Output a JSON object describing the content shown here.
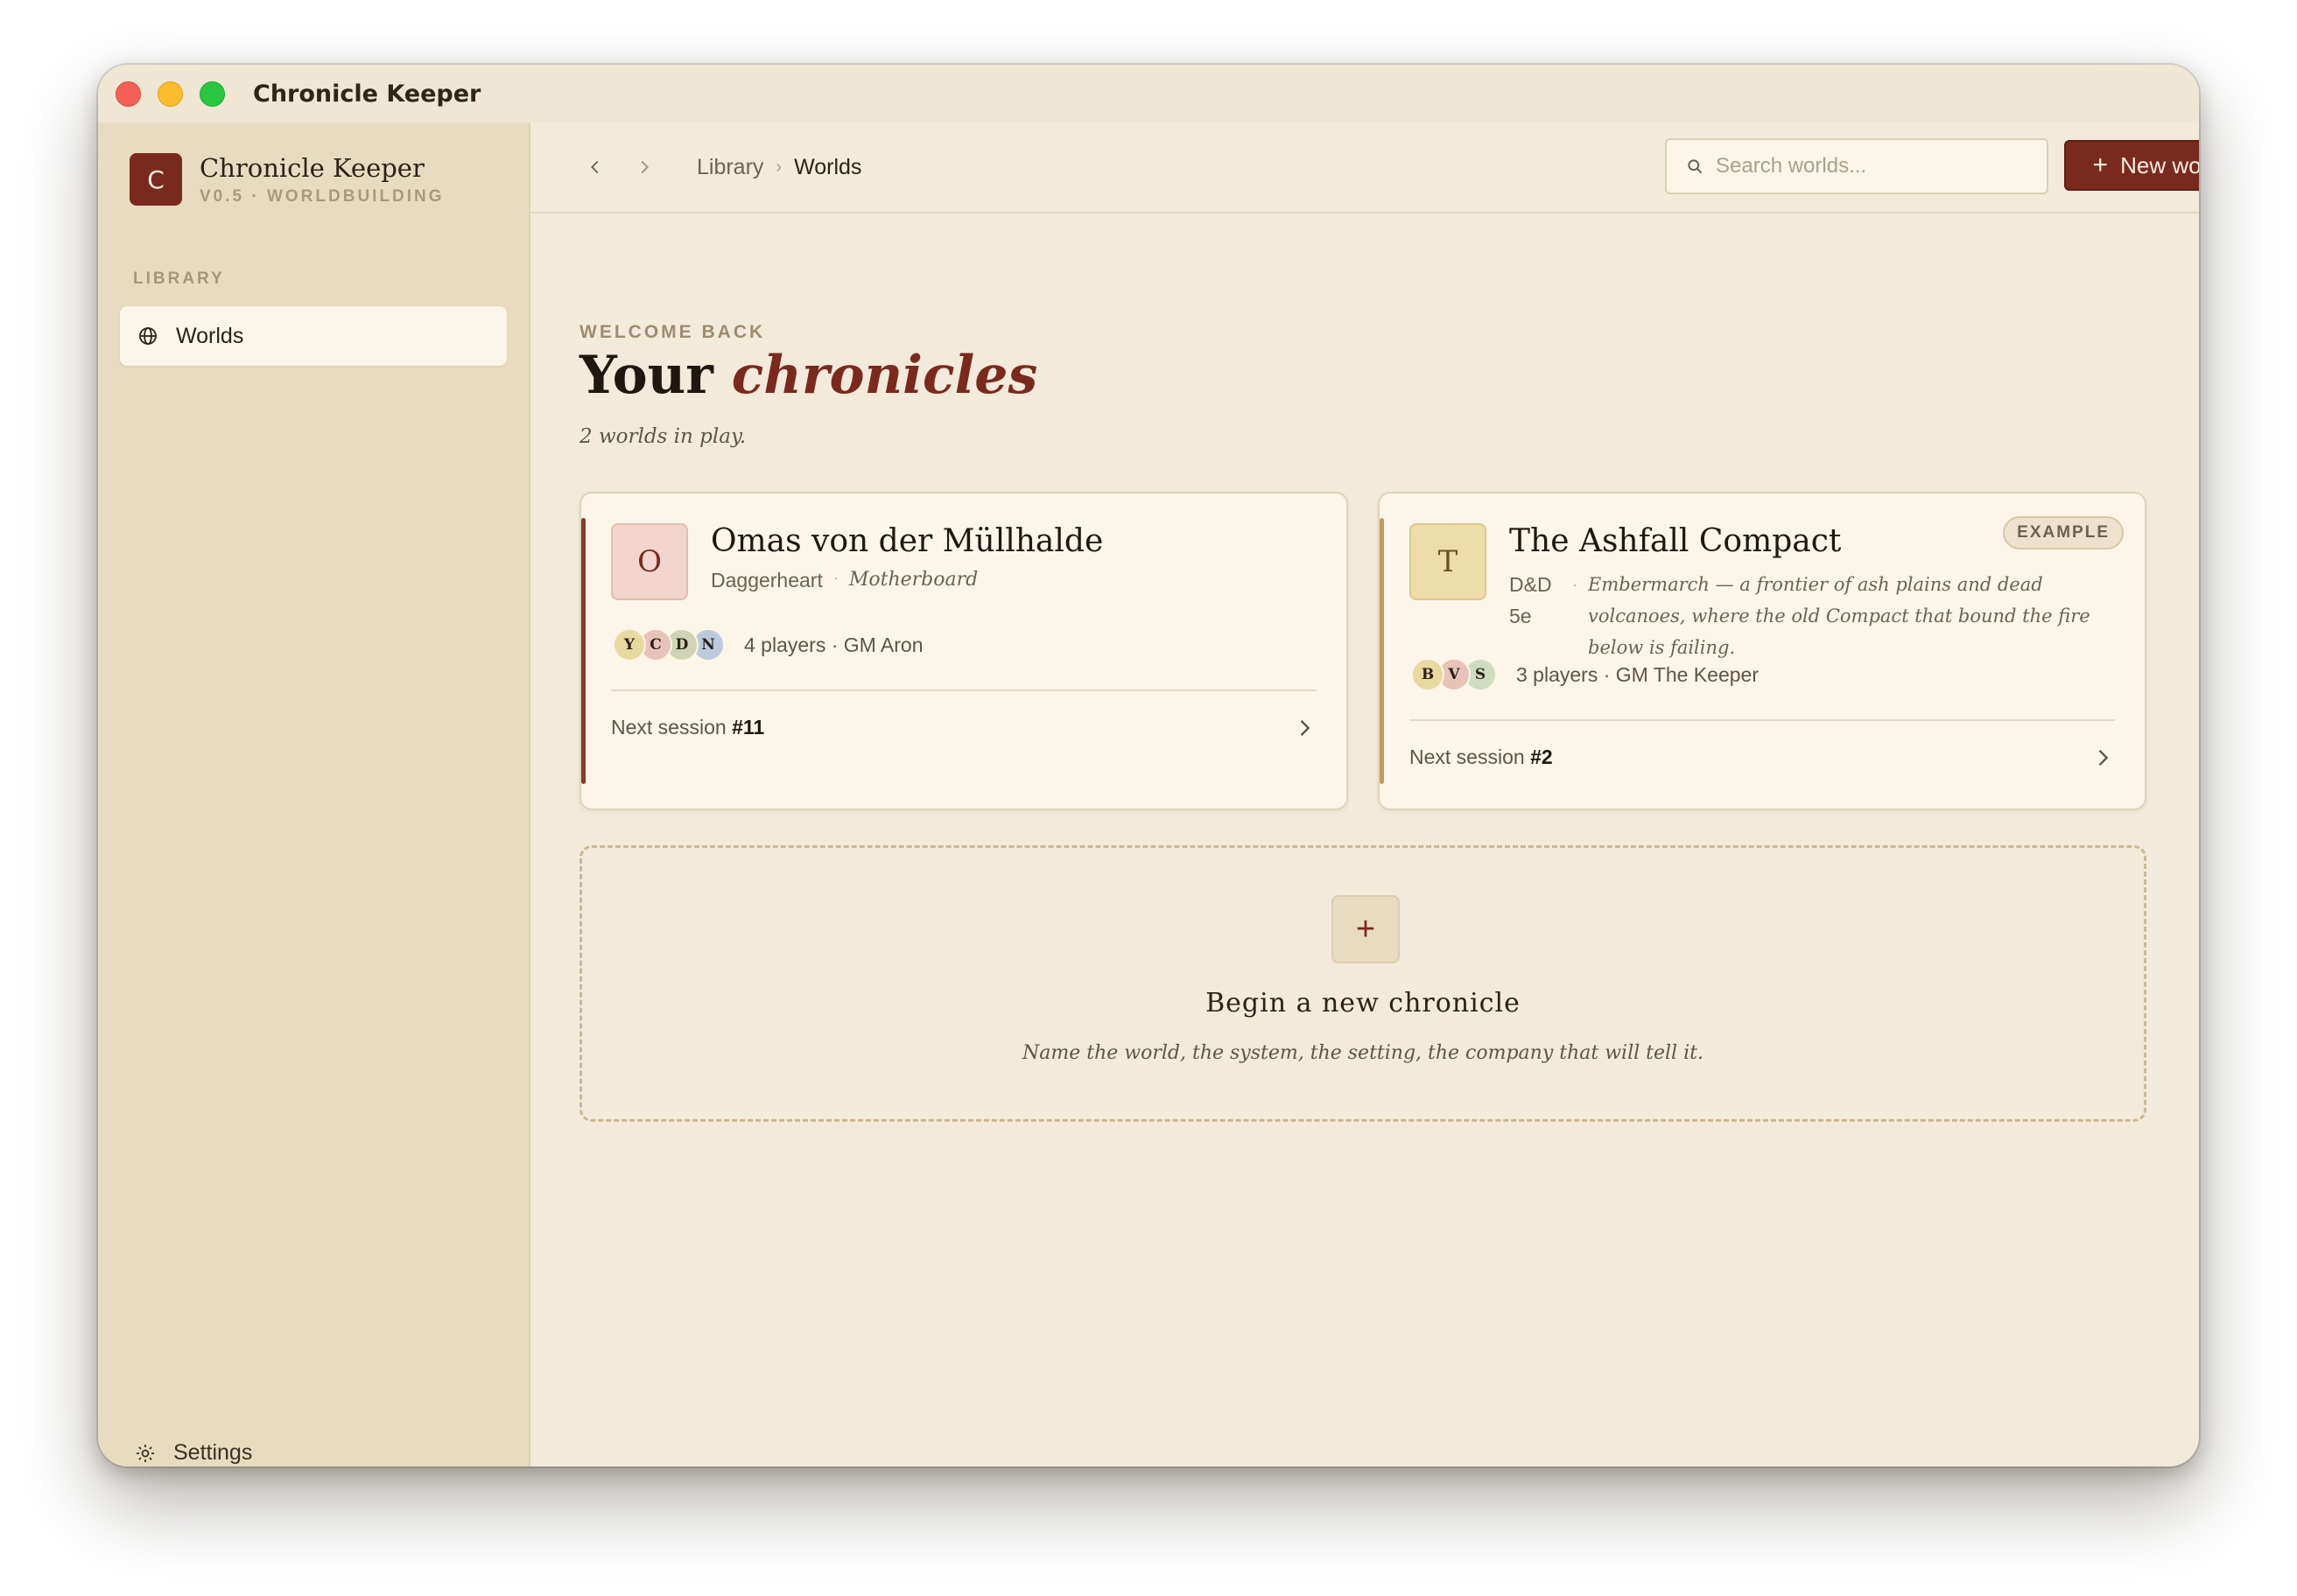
{
  "window": {
    "title": "Chronicle Keeper"
  },
  "sidebar": {
    "brand": {
      "initial": "C",
      "name": "Chronicle Keeper",
      "subtitle": "V0.5 · WORLDBUILDING"
    },
    "section_label": "LIBRARY",
    "items": [
      {
        "label": "Worlds",
        "icon": "globe-icon",
        "active": true
      }
    ],
    "settings_label": "Settings"
  },
  "toolbar": {
    "breadcrumb": [
      "Library",
      "Worlds"
    ],
    "search_placeholder": "Search worlds...",
    "new_world_label": "New world"
  },
  "main": {
    "welcome": "WELCOME BACK",
    "title_prefix": "Your",
    "title_accent": "chronicles",
    "subtitle": "2 worlds in play."
  },
  "worlds": [
    {
      "initial": "O",
      "title": "Omas von der Müllhalde",
      "system": "Daggerheart",
      "setting": "Motherboard",
      "players": [
        {
          "initial": "Y",
          "color": "#e8d9a0"
        },
        {
          "initial": "C",
          "color": "#e8c3b8"
        },
        {
          "initial": "D",
          "color": "#cfd4b4"
        },
        {
          "initial": "N",
          "color": "#bccadb"
        }
      ],
      "players_text": "4 players · GM Aron",
      "next_session_label": "Next session",
      "next_session_number": "#11",
      "accent": "#8a3a25"
    },
    {
      "initial": "T",
      "title": "The Ashfall Compact",
      "badge": "EXAMPLE",
      "system": "D&D 5e",
      "setting": "Embermarch — a frontier of ash plains and dead volcanoes, where the old Compact that bound the fire below is failing.",
      "players": [
        {
          "initial": "B",
          "color": "#e8d9a0"
        },
        {
          "initial": "V",
          "color": "#e8c3b8"
        },
        {
          "initial": "S",
          "color": "#cfdcbd"
        }
      ],
      "players_text": "3 players · GM The Keeper",
      "next_session_label": "Next session",
      "next_session_number": "#2",
      "accent": "#c49a5a"
    }
  ],
  "new_chronicle": {
    "title": "Begin a new chronicle",
    "subtitle": "Name the world, the system, the setting, the company that will tell it."
  }
}
